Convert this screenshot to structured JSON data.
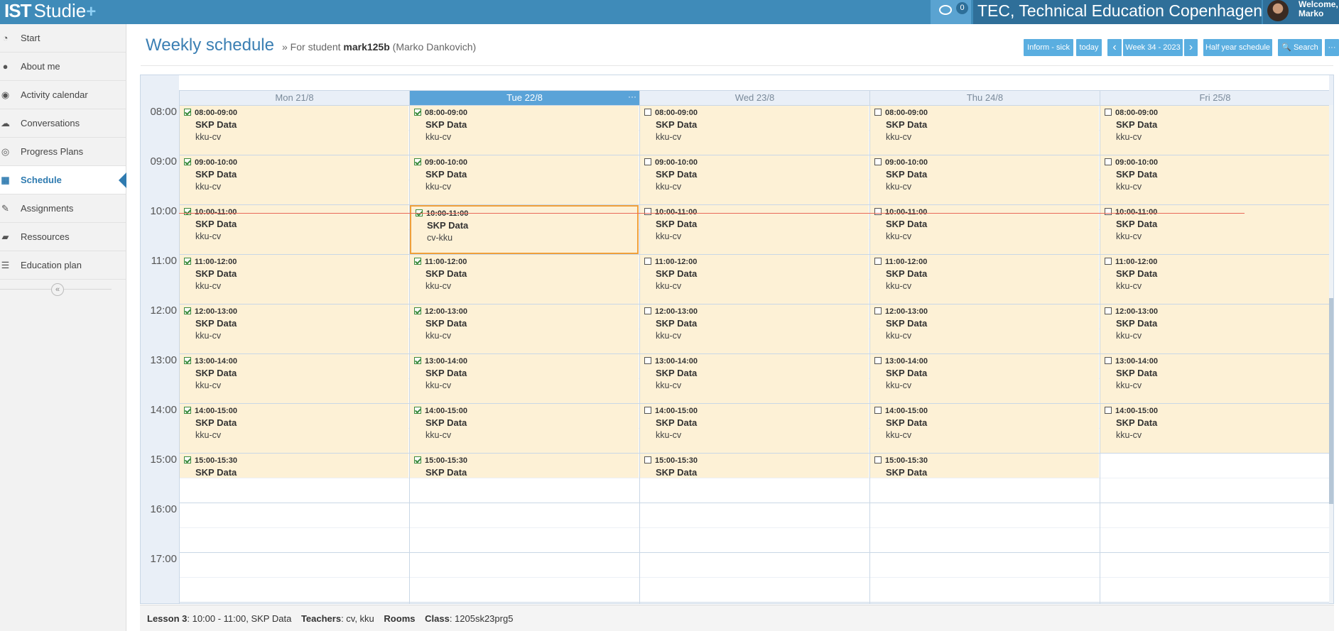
{
  "app": {
    "logo_ist": "IST",
    "logo_studie": "Studie",
    "logo_plus": "+"
  },
  "topbar": {
    "messages_count": "0",
    "institution": "TEC, Technical Education Copenhagen",
    "welcome_line1": "Welcome,",
    "welcome_line2": "Marko"
  },
  "sidebar": {
    "items": [
      {
        "label": "Start",
        "icon": "dashboard-icon",
        "glyph": "◔"
      },
      {
        "label": "About me",
        "icon": "user-icon",
        "glyph": "●"
      },
      {
        "label": "Activity calendar",
        "icon": "eye-icon",
        "glyph": "◉"
      },
      {
        "label": "Conversations",
        "icon": "comments-icon",
        "glyph": "☁"
      },
      {
        "label": "Progress Plans",
        "icon": "target-icon",
        "glyph": "◎"
      },
      {
        "label": "Schedule",
        "icon": "calendar-icon",
        "glyph": "▦",
        "active": true
      },
      {
        "label": "Assignments",
        "icon": "pencil-icon",
        "glyph": "✎"
      },
      {
        "label": "Ressources",
        "icon": "folder-icon",
        "glyph": "▰"
      },
      {
        "label": "Education plan",
        "icon": "list-icon",
        "glyph": "☰"
      }
    ],
    "collapse_glyph": "«"
  },
  "header": {
    "title": "Weekly schedule",
    "subtitle_prefix": "» For student",
    "student_id": "mark125b",
    "student_name": "(Marko Dankovich)"
  },
  "toolbar": {
    "inform_sick": "Inform - sick",
    "today": "today",
    "prev": "‹",
    "week": "Week 34 - 2023",
    "next": "›",
    "half_year": "Half year schedule",
    "search": "🔍 Search",
    "more": "···"
  },
  "calendar": {
    "days": [
      {
        "label": "Mon 21/8",
        "today": false
      },
      {
        "label": "Tue 22/8",
        "today": true
      },
      {
        "label": "Wed 23/8",
        "today": false
      },
      {
        "label": "Thu 24/8",
        "today": false
      },
      {
        "label": "Fri 25/8",
        "today": false
      }
    ],
    "hours": [
      "08:00",
      "09:00",
      "10:00",
      "11:00",
      "12:00",
      "13:00",
      "14:00",
      "15:00",
      "16:00",
      "17:00"
    ],
    "today_menu": "···",
    "lessons": [
      {
        "day": 0,
        "time": "08:00-09:00",
        "subject": "SKP Data",
        "room": "kku-cv",
        "checked": true
      },
      {
        "day": 0,
        "time": "09:00-10:00",
        "subject": "SKP Data",
        "room": "kku-cv",
        "checked": true
      },
      {
        "day": 0,
        "time": "10:00-11:00",
        "subject": "SKP Data",
        "room": "kku-cv",
        "checked": true
      },
      {
        "day": 0,
        "time": "11:00-12:00",
        "subject": "SKP Data",
        "room": "kku-cv",
        "checked": true
      },
      {
        "day": 0,
        "time": "12:00-13:00",
        "subject": "SKP Data",
        "room": "kku-cv",
        "checked": true
      },
      {
        "day": 0,
        "time": "13:00-14:00",
        "subject": "SKP Data",
        "room": "kku-cv",
        "checked": true
      },
      {
        "day": 0,
        "time": "14:00-15:00",
        "subject": "SKP Data",
        "room": "kku-cv",
        "checked": true
      },
      {
        "day": 0,
        "time": "15:00-15:30",
        "subject": "SKP Data",
        "room": "",
        "checked": true
      },
      {
        "day": 1,
        "time": "08:00-09:00",
        "subject": "SKP Data",
        "room": "kku-cv",
        "checked": true
      },
      {
        "day": 1,
        "time": "09:00-10:00",
        "subject": "SKP Data",
        "room": "kku-cv",
        "checked": true
      },
      {
        "day": 1,
        "time": "10:00-11:00",
        "subject": "SKP Data",
        "room": "cv-kku",
        "checked": true,
        "selected": true
      },
      {
        "day": 1,
        "time": "11:00-12:00",
        "subject": "SKP Data",
        "room": "kku-cv",
        "checked": true
      },
      {
        "day": 1,
        "time": "12:00-13:00",
        "subject": "SKP Data",
        "room": "kku-cv",
        "checked": true
      },
      {
        "day": 1,
        "time": "13:00-14:00",
        "subject": "SKP Data",
        "room": "kku-cv",
        "checked": true
      },
      {
        "day": 1,
        "time": "14:00-15:00",
        "subject": "SKP Data",
        "room": "kku-cv",
        "checked": true
      },
      {
        "day": 1,
        "time": "15:00-15:30",
        "subject": "SKP Data",
        "room": "",
        "checked": true
      },
      {
        "day": 2,
        "time": "08:00-09:00",
        "subject": "SKP Data",
        "room": "kku-cv",
        "checked": false
      },
      {
        "day": 2,
        "time": "09:00-10:00",
        "subject": "SKP Data",
        "room": "kku-cv",
        "checked": false
      },
      {
        "day": 2,
        "time": "10:00-11:00",
        "subject": "SKP Data",
        "room": "kku-cv",
        "checked": false
      },
      {
        "day": 2,
        "time": "11:00-12:00",
        "subject": "SKP Data",
        "room": "kku-cv",
        "checked": false
      },
      {
        "day": 2,
        "time": "12:00-13:00",
        "subject": "SKP Data",
        "room": "kku-cv",
        "checked": false
      },
      {
        "day": 2,
        "time": "13:00-14:00",
        "subject": "SKP Data",
        "room": "kku-cv",
        "checked": false
      },
      {
        "day": 2,
        "time": "14:00-15:00",
        "subject": "SKP Data",
        "room": "kku-cv",
        "checked": false
      },
      {
        "day": 2,
        "time": "15:00-15:30",
        "subject": "SKP Data",
        "room": "",
        "checked": false
      },
      {
        "day": 3,
        "time": "08:00-09:00",
        "subject": "SKP Data",
        "room": "kku-cv",
        "checked": false
      },
      {
        "day": 3,
        "time": "09:00-10:00",
        "subject": "SKP Data",
        "room": "kku-cv",
        "checked": false
      },
      {
        "day": 3,
        "time": "10:00-11:00",
        "subject": "SKP Data",
        "room": "kku-cv",
        "checked": false
      },
      {
        "day": 3,
        "time": "11:00-12:00",
        "subject": "SKP Data",
        "room": "kku-cv",
        "checked": false
      },
      {
        "day": 3,
        "time": "12:00-13:00",
        "subject": "SKP Data",
        "room": "kku-cv",
        "checked": false
      },
      {
        "day": 3,
        "time": "13:00-14:00",
        "subject": "SKP Data",
        "room": "kku-cv",
        "checked": false
      },
      {
        "day": 3,
        "time": "14:00-15:00",
        "subject": "SKP Data",
        "room": "kku-cv",
        "checked": false
      },
      {
        "day": 3,
        "time": "15:00-15:30",
        "subject": "SKP Data",
        "room": "",
        "checked": false
      },
      {
        "day": 4,
        "time": "08:00-09:00",
        "subject": "SKP Data",
        "room": "kku-cv",
        "checked": false
      },
      {
        "day": 4,
        "time": "09:00-10:00",
        "subject": "SKP Data",
        "room": "kku-cv",
        "checked": false
      },
      {
        "day": 4,
        "time": "10:00-11:00",
        "subject": "SKP Data",
        "room": "kku-cv",
        "checked": false
      },
      {
        "day": 4,
        "time": "11:00-12:00",
        "subject": "SKP Data",
        "room": "kku-cv",
        "checked": false
      },
      {
        "day": 4,
        "time": "12:00-13:00",
        "subject": "SKP Data",
        "room": "kku-cv",
        "checked": false
      },
      {
        "day": 4,
        "time": "13:00-14:00",
        "subject": "SKP Data",
        "room": "kku-cv",
        "checked": false
      },
      {
        "day": 4,
        "time": "14:00-15:00",
        "subject": "SKP Data",
        "room": "kku-cv",
        "checked": false
      }
    ],
    "now_time": "10:10"
  },
  "footer": {
    "lesson_label": "Lesson 3",
    "lesson_value": ": 10:00 - 11:00, SKP Data",
    "teachers_label": "Teachers",
    "teachers_value": ": cv, kku",
    "rooms_label": "Rooms",
    "class_label": "Class",
    "class_value": ": 1205sk23prg5"
  },
  "colors": {
    "topbar": "#3f8bb9",
    "accent": "#2f7bb0",
    "button": "#5aaee0",
    "event_bg": "#fdf1d6",
    "selected_border": "#f0a03a",
    "now_line": "#e86a5a"
  }
}
